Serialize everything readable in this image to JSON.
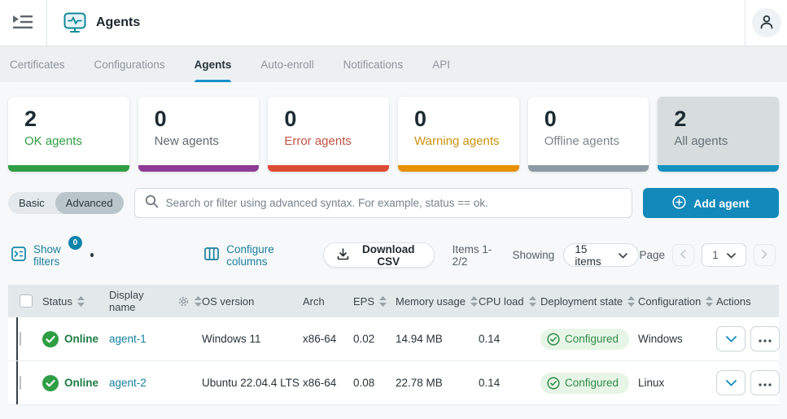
{
  "header": {
    "title": "Agents"
  },
  "tabs": [
    {
      "label": "Certificates",
      "active": false
    },
    {
      "label": "Configurations",
      "active": false
    },
    {
      "label": "Agents",
      "active": true
    },
    {
      "label": "Auto-enroll",
      "active": false
    },
    {
      "label": "Notifications",
      "active": false
    },
    {
      "label": "API",
      "active": false
    }
  ],
  "stats_cards": [
    {
      "value": "2",
      "label": "OK agents",
      "label_color": "#2f9e44",
      "bar_color": "#2f9e44",
      "selected": false
    },
    {
      "value": "0",
      "label": "New agents",
      "label_color": "#5f6a72",
      "bar_color": "#8e3a96",
      "selected": false
    },
    {
      "value": "0",
      "label": "Error agents",
      "label_color": "#bf5240",
      "bar_color": "#dc4b33",
      "selected": false
    },
    {
      "value": "0",
      "label": "Warning agents",
      "label_color": "#c9920f",
      "bar_color": "#e79100",
      "selected": false
    },
    {
      "value": "0",
      "label": "Offline agents",
      "label_color": "#7c868e",
      "bar_color": "#8e9aa3",
      "selected": false
    },
    {
      "value": "2",
      "label": "All agents",
      "label_color": "#66717a",
      "bar_color": "#1591c0",
      "selected": true
    }
  ],
  "filter_bar": {
    "mode_basic": "Basic",
    "mode_advanced": "Advanced",
    "search_placeholder": "Search or filter using advanced syntax. For example, status == ok.",
    "add_button": "Add agent"
  },
  "toolbar": {
    "show_filters": "Show filters",
    "filters_badge": "0",
    "configure_columns": "Configure columns",
    "download_csv": "Download CSV",
    "items_range": "Items 1-2/2",
    "showing_label": "Showing",
    "page_size": "15 items",
    "page_label": "Page",
    "page_number": "1"
  },
  "table": {
    "columns": {
      "status": "Status",
      "display_name": "Display name",
      "os_version": "OS version",
      "arch": "Arch",
      "eps": "EPS",
      "memory": "Memory usage",
      "cpu": "CPU load",
      "deployment": "Deployment state",
      "configuration": "Configuration",
      "actions": "Actions"
    },
    "rows": [
      {
        "status": "Online",
        "name": "agent-1",
        "os": "Windows 11",
        "arch": "x86-64",
        "eps": "0.02",
        "memory": "14.94 MB",
        "cpu": "0.14",
        "deployment": "Configured",
        "configuration": "Windows"
      },
      {
        "status": "Online",
        "name": "agent-2",
        "os": "Ubuntu 22.04.4 LTS",
        "arch": "x86-64",
        "eps": "0.08",
        "memory": "22.78 MB",
        "cpu": "0.14",
        "deployment": "Configured",
        "configuration": "Linux"
      }
    ]
  },
  "colors": {
    "accent_blue": "#1289ba",
    "accent_teal_link": "#16809f",
    "ok_green": "#2f9e44",
    "badge_green_bg": "#e7f5e7",
    "tab_underline": "#1791c9"
  }
}
